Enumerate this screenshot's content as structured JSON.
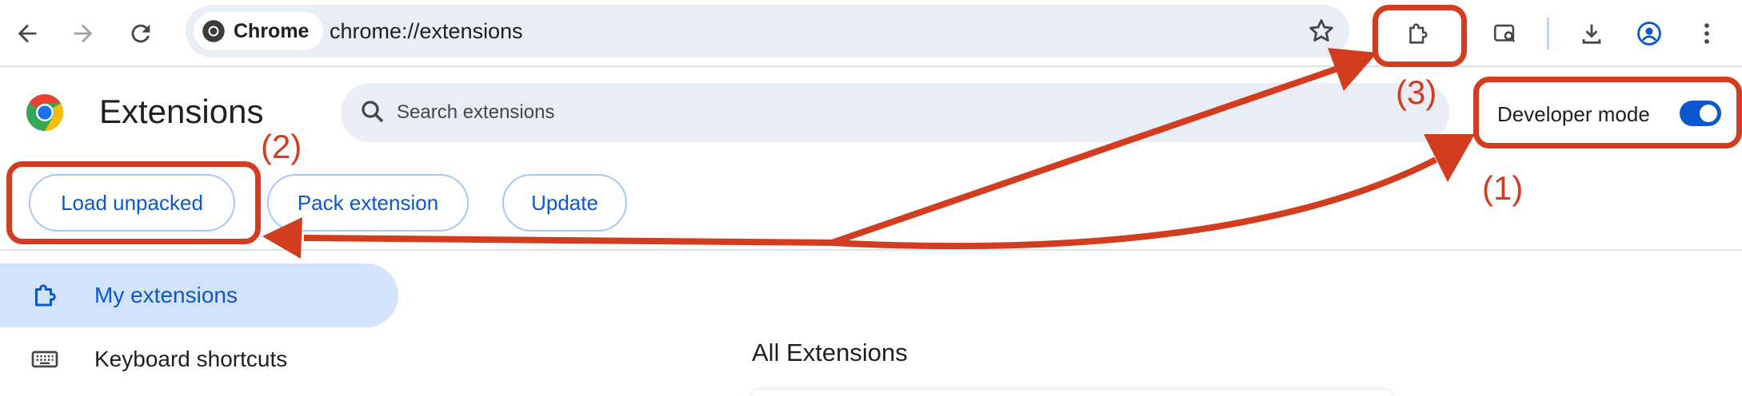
{
  "browser": {
    "chip_label": "Chrome",
    "url": "chrome://extensions"
  },
  "header": {
    "title": "Extensions",
    "search_placeholder": "Search extensions",
    "developer_mode_label": "Developer mode",
    "developer_mode_on": true
  },
  "actions": {
    "load_unpacked": "Load unpacked",
    "pack_extension": "Pack extension",
    "update": "Update"
  },
  "sidebar": {
    "items": [
      {
        "label": "My extensions",
        "icon": "puzzle-icon",
        "active": true
      },
      {
        "label": "Keyboard shortcuts",
        "icon": "keyboard-icon",
        "active": false
      }
    ]
  },
  "main": {
    "section_title": "All Extensions"
  },
  "annotations": {
    "labels": [
      "(1)",
      "(2)",
      "(3)"
    ],
    "color": "#d23c1f"
  },
  "colors": {
    "accent": "#0b57d0",
    "active_nav_bg": "#d3e3fd",
    "omnibox_bg": "#e9eef6"
  }
}
